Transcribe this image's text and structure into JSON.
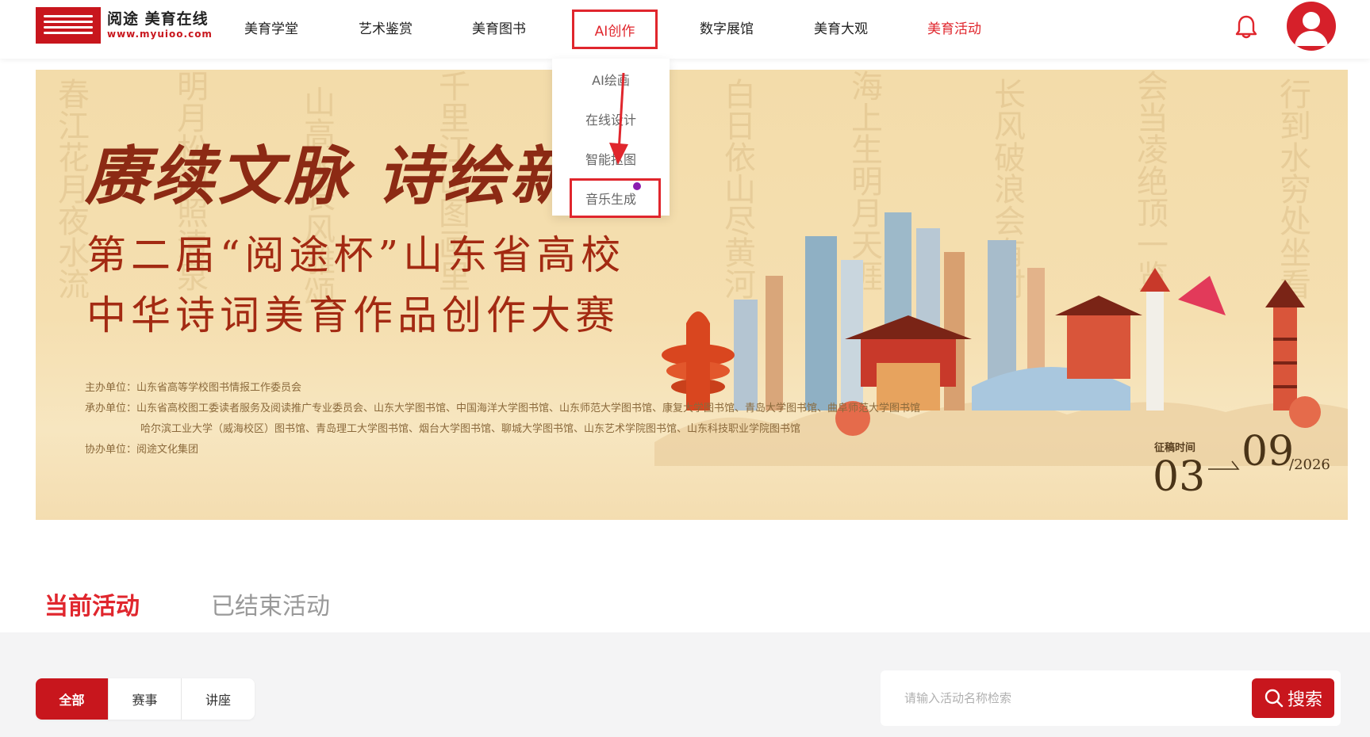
{
  "header": {
    "logo_cn": "阅途 美育在线",
    "logo_en": "www.myuioo.com",
    "nav": [
      {
        "label": "美育学堂"
      },
      {
        "label": "艺术鉴赏"
      },
      {
        "label": "美育图书"
      },
      {
        "label": "AI创作"
      },
      {
        "label": "数字展馆"
      },
      {
        "label": "美育大观"
      },
      {
        "label": "美育活动"
      }
    ],
    "bell_icon": "bell-icon",
    "avatar_icon": "user-avatar-icon"
  },
  "dropdown": {
    "items": [
      {
        "label": "AI绘画"
      },
      {
        "label": "在线设计"
      },
      {
        "label": "智能抠图"
      },
      {
        "label": "音乐生成"
      }
    ]
  },
  "banner": {
    "title1": "赓续文脉  诗绘新",
    "title2": "第二届“阅途杯”山东省高校",
    "title3": "中华诗词美育作品创作大赛",
    "organizer": "主办单位：山东省高等学校图书情报工作委员会",
    "undertaker_line1": "承办单位：山东省高校图工委读者服务及阅读推广专业委员会、山东大学图书馆、中国海洋大学图书馆、山东师范大学图书馆、康复大学图书馆、青岛大学图书馆、曲阜师范大学图书馆",
    "undertaker_line2": "哈尔滨工业大学（威海校区）图书馆、青岛理工大学图书馆、烟台大学图书馆、聊城大学图书馆、山东艺术学院图书馆、山东科技职业学院图书馆",
    "co_organizer": "协办单位：阅途文化集团",
    "deadline_label": "征稿时间",
    "deadline_start": "03",
    "deadline_end": "09",
    "deadline_year": "/2026"
  },
  "tabs": {
    "current": "当前活动",
    "ended": "已结束活动"
  },
  "filter": {
    "options": [
      "全部",
      "赛事",
      "讲座"
    ],
    "search_placeholder": "请输入活动名称检索",
    "search_button": "搜索"
  },
  "colors": {
    "accent": "#c8161d",
    "accent_text": "#e0262d",
    "banner_title": "#8c2a14"
  }
}
